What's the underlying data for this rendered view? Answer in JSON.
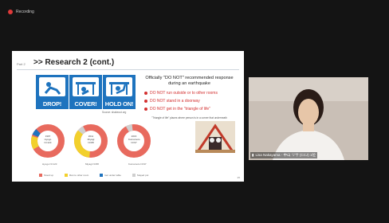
{
  "recording": {
    "label": "Recording"
  },
  "slide": {
    "part": "Part 2",
    "title": ">> Research 2 (cont.)",
    "drill_buttons": [
      "DROP!",
      "COVER!",
      "HOLD ON!"
    ],
    "source": "Source: shakeout.org",
    "heading": "Officially \"DO NOT\" recommended response during an earthquake",
    "bullets": [
      "DO NOT run outside or to other rooms",
      "DO NOT stand in a doorway",
      "DO NOT get in the \"triangle of life\""
    ],
    "note": "\"Triangle of life\" places where person is in a corner that underneath",
    "donuts": [
      {
        "label": "1997 Hyogo N=123",
        "caption": "Hyogo N=123"
      },
      {
        "label": "2011 Miyagi N=88",
        "caption": "Miyagi N=88"
      },
      {
        "label": "2016 Kumamoto N=97",
        "caption": "Kumamoto N=97"
      }
    ],
    "legend": [
      "Stood up",
      "Ran to other room",
      "Got under table",
      "Stayed put"
    ],
    "page_number": "25",
    "colors": {
      "red": "#e86a5e",
      "yellow": "#f2d02c",
      "blue": "#1e73be",
      "gray": "#cfcfcf"
    }
  },
  "camera": {
    "name": "Lisa Nakayama - 中山 リサ (CCJ) 1位"
  }
}
